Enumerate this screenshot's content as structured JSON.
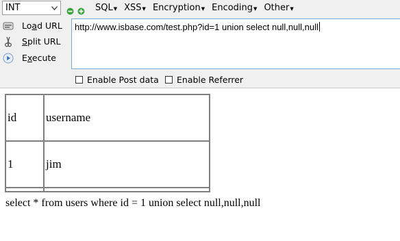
{
  "toolbar": {
    "select": {
      "value": "INT"
    },
    "menus": [
      {
        "label": "SQL"
      },
      {
        "label": "XSS"
      },
      {
        "label": "Encryption"
      },
      {
        "label": "Encoding"
      },
      {
        "label": "Other"
      }
    ],
    "buttons": {
      "load_url_prefix": "Lo",
      "load_url_underline": "a",
      "load_url_suffix": "d URL",
      "split_url_underline": "S",
      "split_url_suffix": "plit URL",
      "execute_prefix": "E",
      "execute_underline": "x",
      "execute_suffix": "ecute"
    },
    "url_value": "http://www.isbase.com/test.php?id=1 union select null,null,null",
    "checkboxes": {
      "post_label": "Enable Post data",
      "referrer_label": "Enable Referrer"
    }
  },
  "result": {
    "table": {
      "rows": [
        [
          "id",
          "username"
        ],
        [
          "1",
          "jim"
        ]
      ]
    },
    "query": "select * from users where id = 1 union select null,null,null"
  }
}
